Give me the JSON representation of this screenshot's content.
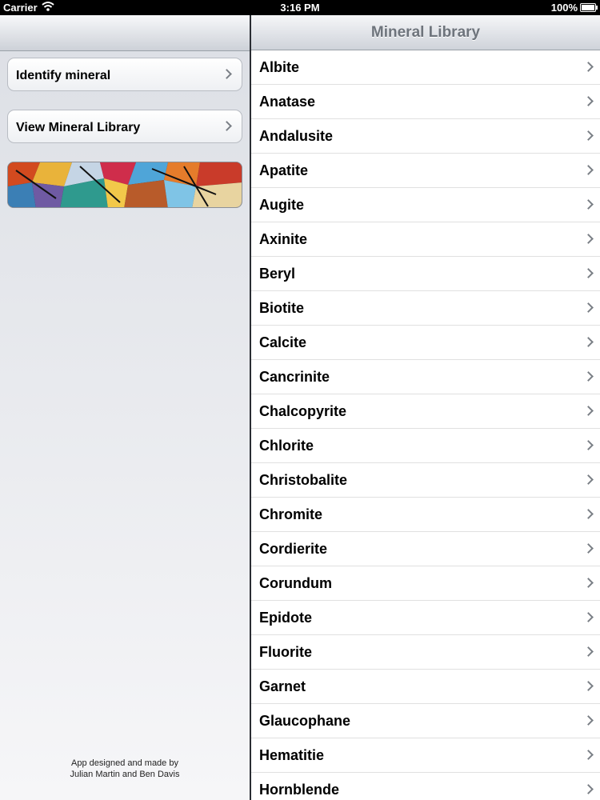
{
  "status_bar": {
    "carrier": "Carrier",
    "time": "3:16 PM",
    "battery": "100%"
  },
  "left_pane": {
    "menu": [
      {
        "label": "Identify mineral"
      },
      {
        "label": "View Mineral Library"
      }
    ],
    "credit_line1": "App designed and made by",
    "credit_line2": "Julian Martin and Ben Davis"
  },
  "right_pane": {
    "title": "Mineral Library",
    "minerals": [
      "Albite",
      "Anatase",
      "Andalusite",
      "Apatite",
      "Augite",
      "Axinite",
      "Beryl",
      "Biotite",
      "Calcite",
      "Cancrinite",
      "Chalcopyrite",
      "Chlorite",
      "Christobalite",
      "Chromite",
      "Cordierite",
      "Corundum",
      "Epidote",
      "Fluorite",
      "Garnet",
      "Glaucophane",
      "Hematitie",
      "Hornblende"
    ]
  }
}
